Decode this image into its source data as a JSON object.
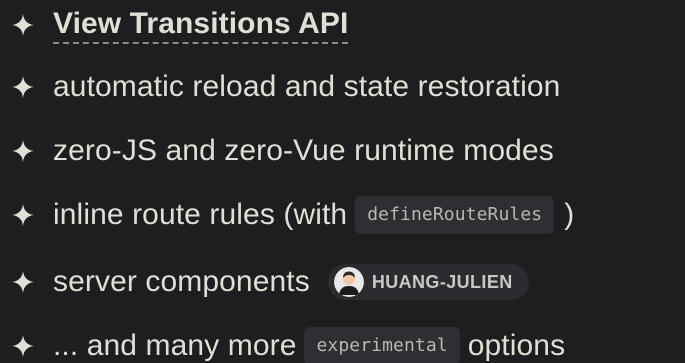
{
  "items": [
    {
      "text": "View Transitions API"
    },
    {
      "text": "automatic reload and state restoration"
    },
    {
      "text": "zero-JS and zero-Vue runtime modes"
    },
    {
      "text_before": "inline route rules (with",
      "code": "defineRouteRules",
      "text_after": ")"
    },
    {
      "text": "server components",
      "user": "HUANG-JULIEN"
    },
    {
      "text_before": "... and many more",
      "code": "experimental",
      "text_after": "options"
    }
  ],
  "icons": {
    "bullet": "sparkle-icon",
    "avatar": "user-avatar-icon"
  },
  "colors": {
    "background": "#1e1e20",
    "text": "#dfdfd6",
    "code_background": "#2e2e33",
    "badge_background": "#2c2c30"
  }
}
